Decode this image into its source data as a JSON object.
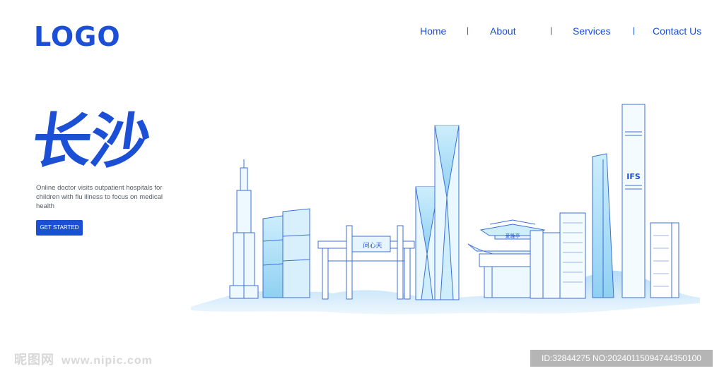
{
  "header": {
    "logo": "LOGO",
    "nav": [
      "Home",
      "About",
      "Services",
      "Contact Us"
    ],
    "separator": "|"
  },
  "hero": {
    "title": "长沙",
    "description": "Online doctor visits outpatient hospitals for children with flu illness to focus on medical health",
    "cta_label": "GET STARTED"
  },
  "skyline": {
    "gate_sign": "问心天",
    "pavilion_sign": "爱晚亭",
    "tower_sign": "IFS"
  },
  "watermark": {
    "site_name": "昵图网",
    "site_url": "www.nipic.com",
    "image_info": "ID:32844275 NO:20240115094744350100"
  },
  "colors": {
    "brand": "#1a4fd6",
    "line": "#3d6fd8",
    "fill_light": "#bfe4f8",
    "ground": "#cfe6fa"
  }
}
